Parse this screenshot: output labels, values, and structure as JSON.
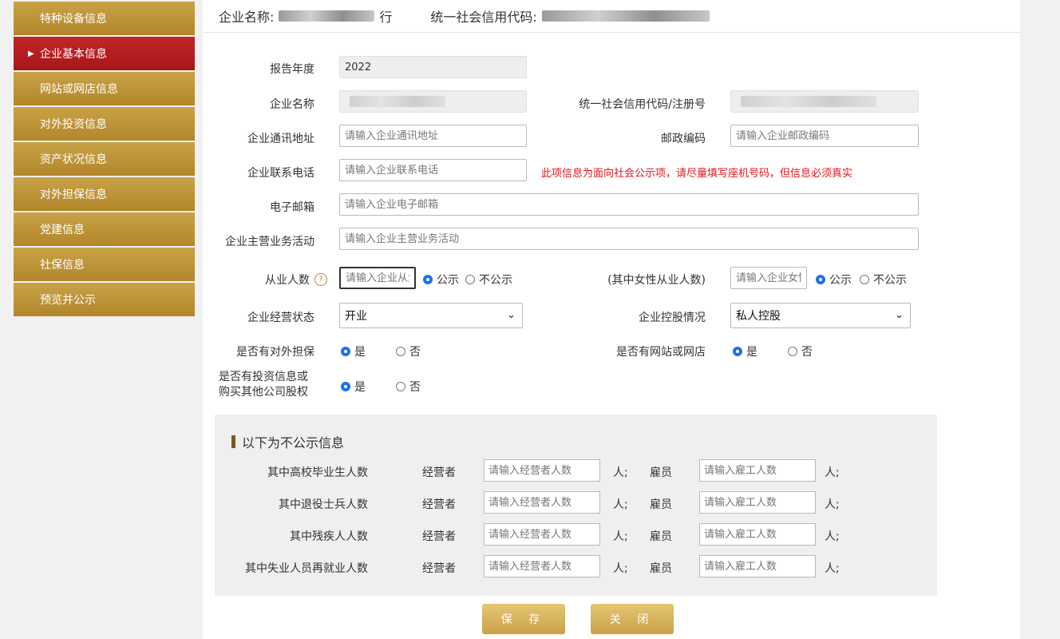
{
  "sidebar": {
    "items": [
      {
        "label": "特种设备信息"
      },
      {
        "label": "企业基本信息"
      },
      {
        "label": "网站或网店信息"
      },
      {
        "label": "对外投资信息"
      },
      {
        "label": "资产状况信息"
      },
      {
        "label": "对外担保信息"
      },
      {
        "label": "党建信息"
      },
      {
        "label": "社保信息"
      },
      {
        "label": "预览并公示"
      }
    ]
  },
  "header": {
    "company_label": "企业名称:",
    "company_suffix": "行",
    "code_label": "统一社会信用代码:"
  },
  "form": {
    "report_year_label": "报告年度",
    "report_year_value": "2022",
    "company_name_label": "企业名称",
    "credit_code_label": "统一社会信用代码/注册号",
    "address_label": "企业通讯地址",
    "address_placeholder": "请输入企业通讯地址",
    "postcode_label": "邮政编码",
    "postcode_placeholder": "请输入企业邮政编码",
    "phone_label": "企业联系电话",
    "phone_placeholder": "请输入企业联系电话",
    "phone_warning": "此项信息为面向社会公示项，请尽量填写座机号码，但信息必须真实",
    "email_label": "电子邮箱",
    "email_placeholder": "请输入企业电子邮箱",
    "business_label": "企业主营业务活动",
    "business_placeholder": "请输入企业主营业务活动",
    "employees_label": "从业人数",
    "employees_placeholder": "请输入企业从业人数",
    "female_label": "(其中女性从业人数)",
    "female_placeholder": "请输入企业女性从业人数",
    "public_option": "公示",
    "nonpublic_option": "不公示",
    "status_label": "企业经营状态",
    "status_value": "开业",
    "holding_label": "企业控股情况",
    "holding_value": "私人控股",
    "guarantee_label": "是否有对外担保",
    "website_label": "是否有网站或网店",
    "invest_label_line1": "是否有投资信息或",
    "invest_label_line2": "购买其他公司股权",
    "yes": "是",
    "no": "否"
  },
  "private_section": {
    "title": "以下为不公示信息",
    "operator_label": "经营者",
    "employee_label": "雇员",
    "operator_placeholder": "请输入经营者人数",
    "employee_placeholder": "请输入雇工人数",
    "unit": "人;",
    "rows": [
      {
        "label": "其中高校毕业生人数"
      },
      {
        "label": "其中退役士兵人数"
      },
      {
        "label": "其中残疾人人数"
      },
      {
        "label": "其中失业人员再就业人数"
      }
    ]
  },
  "buttons": {
    "save": "保 存",
    "close": "关 闭"
  },
  "colors": {
    "sidebar_gold": "#b8902f",
    "sidebar_active": "#b21d20",
    "warning_red": "#e4141b",
    "radio_blue": "#1a73e8"
  }
}
